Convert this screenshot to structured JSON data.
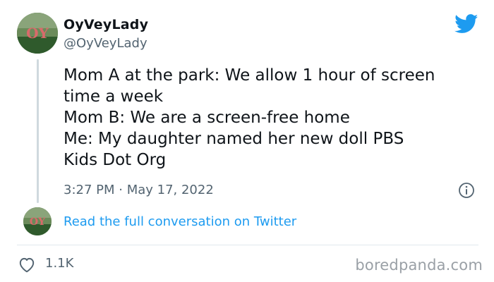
{
  "author": {
    "display_name": "OyVeyLady",
    "handle": "@OyVeyLady",
    "avatar_icon": "oy-sign-avatar"
  },
  "tweet": {
    "lines": [
      "Mom A at the park: We allow 1 hour of screen",
      "time a week",
      "Mom B: We are a screen-free home",
      "Me: My daughter named her new doll PBS",
      "Kids Dot Org"
    ],
    "timestamp": "3:27 PM · May 17, 2022"
  },
  "conversation": {
    "link_label": "Read the full conversation on Twitter"
  },
  "footer": {
    "like_count": "1.1K",
    "watermark": "boredpanda.com"
  },
  "icons": {
    "brand": "twitter-bird-icon",
    "info": "info-icon",
    "like": "heart-icon"
  },
  "colors": {
    "brand_blue": "#1d9bf0",
    "text": "#0f1419",
    "secondary_text": "#536471",
    "divider": "#e1e8ed"
  }
}
